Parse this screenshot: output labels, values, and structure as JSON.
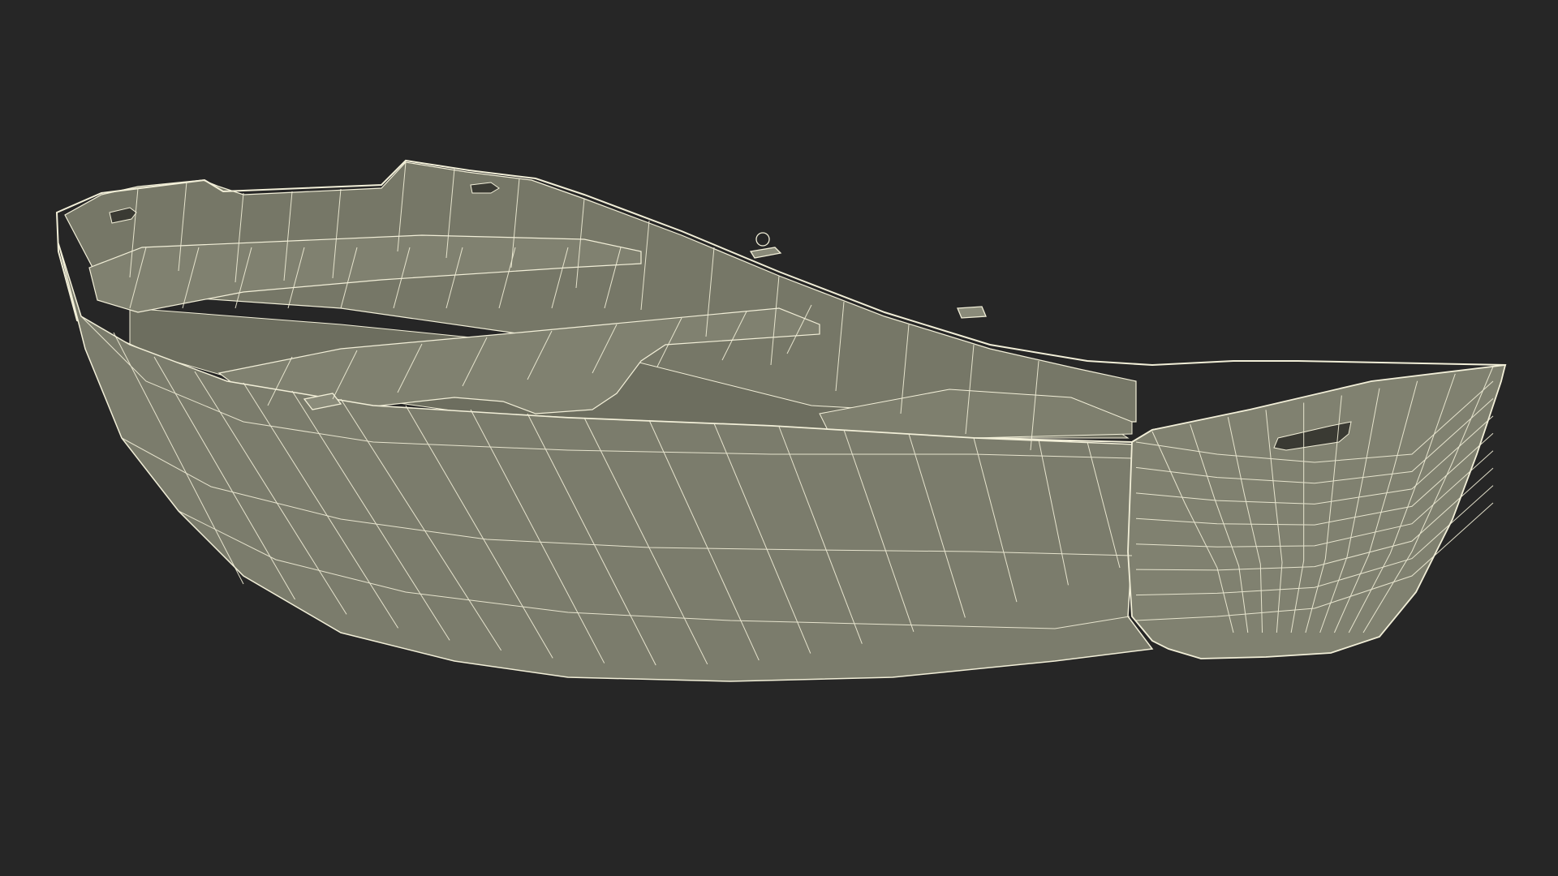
{
  "scene": {
    "subject": "boat-hull-wireframe",
    "colors": {
      "background": "#262626",
      "surface": "#7b7c6c",
      "surface_dark": "#6a6b5c",
      "surface_light": "#8a8b7a",
      "wire": "#f2efd8"
    }
  }
}
